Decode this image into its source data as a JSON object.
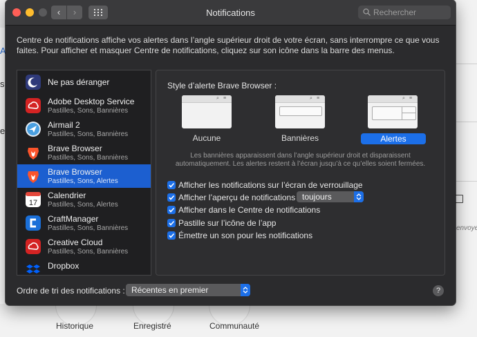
{
  "background": {
    "left_fragments": [
      "A",
      "s",
      "e"
    ],
    "right_text": "envoyer c",
    "bottom_labels": [
      "Historique",
      "Enregistré",
      "Communauté"
    ]
  },
  "window": {
    "title": "Notifications",
    "search_placeholder": "Rechercher",
    "intro": "Centre de notifications affiche vos alertes dans l’angle supérieur droit de votre écran, sans interrompre ce que vous faites. Pour afficher et masquer Centre de notifications, cliquez sur son icône dans la barre des menus."
  },
  "apps": [
    {
      "name": "Ne pas déranger",
      "sub": "",
      "icon": "moon-icon",
      "color": "#2f3a7a"
    },
    {
      "name": "Adobe Desktop Service",
      "sub": "Pastilles, Sons, Bannières",
      "icon": "adobe-cc-icon",
      "color": "#d42323"
    },
    {
      "name": "Airmail 2",
      "sub": "Pastilles, Sons, Bannières",
      "icon": "airmail-icon",
      "color": "#4a9fe0"
    },
    {
      "name": "Brave Browser",
      "sub": "Pastilles, Sons, Bannières",
      "icon": "brave-lion-icon",
      "color": "#fb542b"
    },
    {
      "name": "Brave Browser",
      "sub": "Pastilles, Sons, Alertes",
      "icon": "brave-lion-icon",
      "color": "#fb542b"
    },
    {
      "name": "Calendrier",
      "sub": "Pastilles, Sons, Alertes",
      "icon": "calendar-icon",
      "color": "#ffffff",
      "day": "17"
    },
    {
      "name": "CraftManager",
      "sub": "Pastilles, Sons, Bannières",
      "icon": "craftmanager-icon",
      "color": "#1a6fd8"
    },
    {
      "name": "Creative Cloud",
      "sub": "Pastilles, Sons, Bannières",
      "icon": "creative-cloud-icon",
      "color": "#d42323"
    },
    {
      "name": "Dropbox",
      "sub": "",
      "icon": "dropbox-icon",
      "color": "#0061fe"
    }
  ],
  "panel": {
    "title": "Style d’alerte Brave Browser :",
    "styles": [
      "Aucune",
      "Bannières",
      "Alertes"
    ],
    "selected_style": "Alertes",
    "hint": "Les bannières apparaissent dans l’angle supérieur droit et disparaissent automatiquement. Les alertes restent à l’écran jusqu’à ce qu’elles soient fermées.",
    "options": [
      {
        "label": "Afficher les notifications sur l’écran de verrouillage",
        "checked": true
      },
      {
        "label": "Afficher l’aperçu de notifications",
        "checked": true
      },
      {
        "label": "Afficher dans le Centre de notifications",
        "checked": true
      },
      {
        "label": "Pastille sur l’icône de l’app",
        "checked": true
      },
      {
        "label": "Émettre un son pour les notifications",
        "checked": true
      }
    ],
    "preview_select": "toujours"
  },
  "footer": {
    "sort_label": "Ordre de tri des notifications :",
    "sort_value": "Récentes en premier",
    "help": "?"
  }
}
